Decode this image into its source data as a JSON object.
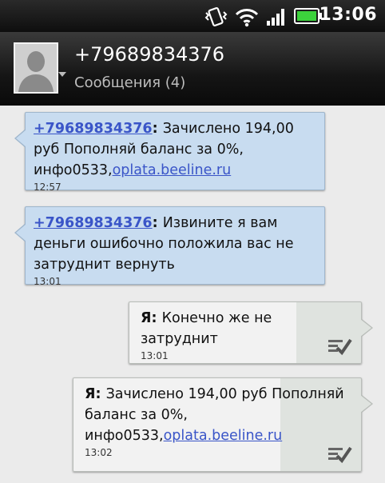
{
  "status_bar": {
    "time": "13:06",
    "icons": [
      "vibrate-icon",
      "wifi-icon",
      "signal-icon",
      "battery-icon"
    ],
    "battery_color": "#3cd23c"
  },
  "header": {
    "contact_number": "+79689834376",
    "subtitle": "Сообщения (4)"
  },
  "messages": [
    {
      "direction": "incoming",
      "sender": "+79689834376",
      "text": "Зачислено 194,00 руб Пополняй баланс за 0%, инфо0533,",
      "link": "oplata.beeline.ru",
      "time": "12:57"
    },
    {
      "direction": "incoming",
      "sender": "+79689834376",
      "text": "Извините я вам деньги ошибочно положила вас не затруднит вернуть",
      "time": "13:01"
    },
    {
      "direction": "outgoing",
      "sender": "Я",
      "text": "Конечно же не затруднит",
      "time": "13:01",
      "status_icon": "delivered-check-icon"
    },
    {
      "direction": "outgoing",
      "sender": "Я",
      "text": "Зачислено 194,00 руб Пополняй баланс за 0%, инфо0533,",
      "link": "oplata.beeline.ru",
      "time": "13:02",
      "status_icon": "delivered-check-icon"
    }
  ],
  "colors": {
    "incoming_bubble": "#c8dcf0",
    "outgoing_bubble": "#f2f2f2",
    "link": "#3a55c8"
  }
}
